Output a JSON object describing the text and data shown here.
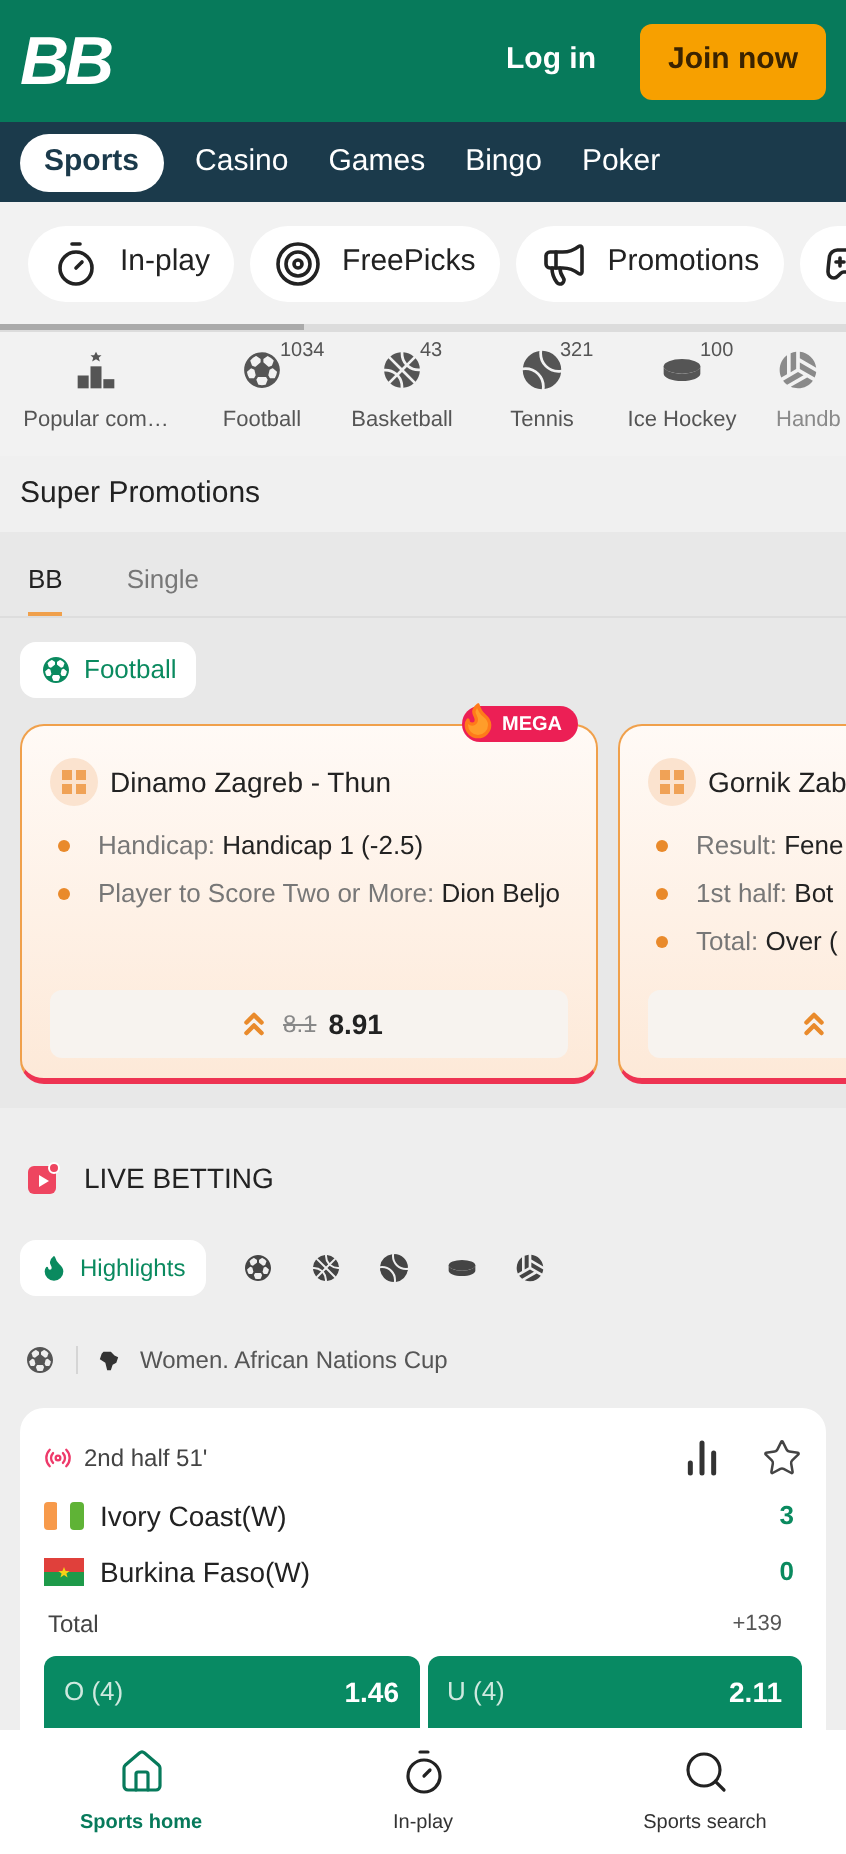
{
  "header": {
    "logo": "BB",
    "login": "Log in",
    "join": "Join now"
  },
  "top_nav": [
    {
      "label": "Sports",
      "selected": true
    },
    {
      "label": "Casino",
      "selected": false
    },
    {
      "label": "Games",
      "selected": false
    },
    {
      "label": "Bingo",
      "selected": false
    },
    {
      "label": "Poker",
      "selected": false
    }
  ],
  "quick_links": [
    {
      "kind": "timer",
      "label": "In-play"
    },
    {
      "kind": "target",
      "label": "FreePicks"
    },
    {
      "kind": "megaphone",
      "label": "Promotions"
    },
    {
      "kind": "gamepad"
    }
  ],
  "sports": [
    {
      "kind": "podium",
      "label": "Popular com…"
    },
    {
      "kind": "football",
      "label": "Football",
      "count": "1034"
    },
    {
      "kind": "basketball",
      "label": "Basketball",
      "count": "43"
    },
    {
      "kind": "tennis",
      "label": "Tennis",
      "count": "321"
    },
    {
      "kind": "puck",
      "label": "Ice Hockey",
      "count": "100"
    },
    {
      "kind": "handball",
      "label": "Handb"
    }
  ],
  "super_promotions": {
    "title": "Super Promotions",
    "tabs": [
      {
        "label": "BB",
        "selected": true
      },
      {
        "label": "Single",
        "selected": false
      }
    ],
    "filter": {
      "label": "Football"
    },
    "cards": [
      {
        "match": "Dinamo Zagreb - Thun",
        "badge": "MEGA",
        "selections": [
          {
            "market": "Handicap:",
            "pick": "Handicap 1 (-2.5)"
          },
          {
            "market": "Player to Score Two or More:",
            "pick": "Dion Beljo"
          }
        ],
        "old_odds": "8.1",
        "odds": "8.91"
      },
      {
        "match": "Gornik Zab",
        "selections": [
          {
            "market": "Result:",
            "pick": "Fene"
          },
          {
            "market": "1st half:",
            "pick": "Bot"
          },
          {
            "market": "Total:",
            "pick": "Over ("
          }
        ]
      }
    ]
  },
  "live": {
    "title": "LIVE BETTING",
    "filters": [
      {
        "kind": "label",
        "label": "Highlights",
        "selected": true
      },
      {
        "kind": "football",
        "selected": false
      },
      {
        "kind": "basketball",
        "selected": false
      },
      {
        "kind": "tennis",
        "selected": false
      },
      {
        "kind": "puck",
        "selected": false
      },
      {
        "kind": "handball",
        "selected": false
      }
    ],
    "league": "Women. African Nations Cup",
    "match": {
      "status": "2nd half 51'",
      "teams": [
        {
          "name": "Ivory Coast(W)",
          "score": "3",
          "kind": "ci"
        },
        {
          "name": "Burkina Faso(W)",
          "score": "0",
          "kind": "bf"
        }
      ],
      "market": "Total",
      "more": "+139",
      "outcomes": [
        {
          "label": "O (4)",
          "odds": "1.46"
        },
        {
          "label": "U (4)",
          "odds": "2.11"
        }
      ]
    }
  },
  "bottom_nav": [
    {
      "kind": "home",
      "label": "Sports home",
      "selected": true
    },
    {
      "kind": "timer",
      "label": "In-play",
      "selected": false
    },
    {
      "kind": "search",
      "label": "Sports search",
      "selected": false
    }
  ]
}
